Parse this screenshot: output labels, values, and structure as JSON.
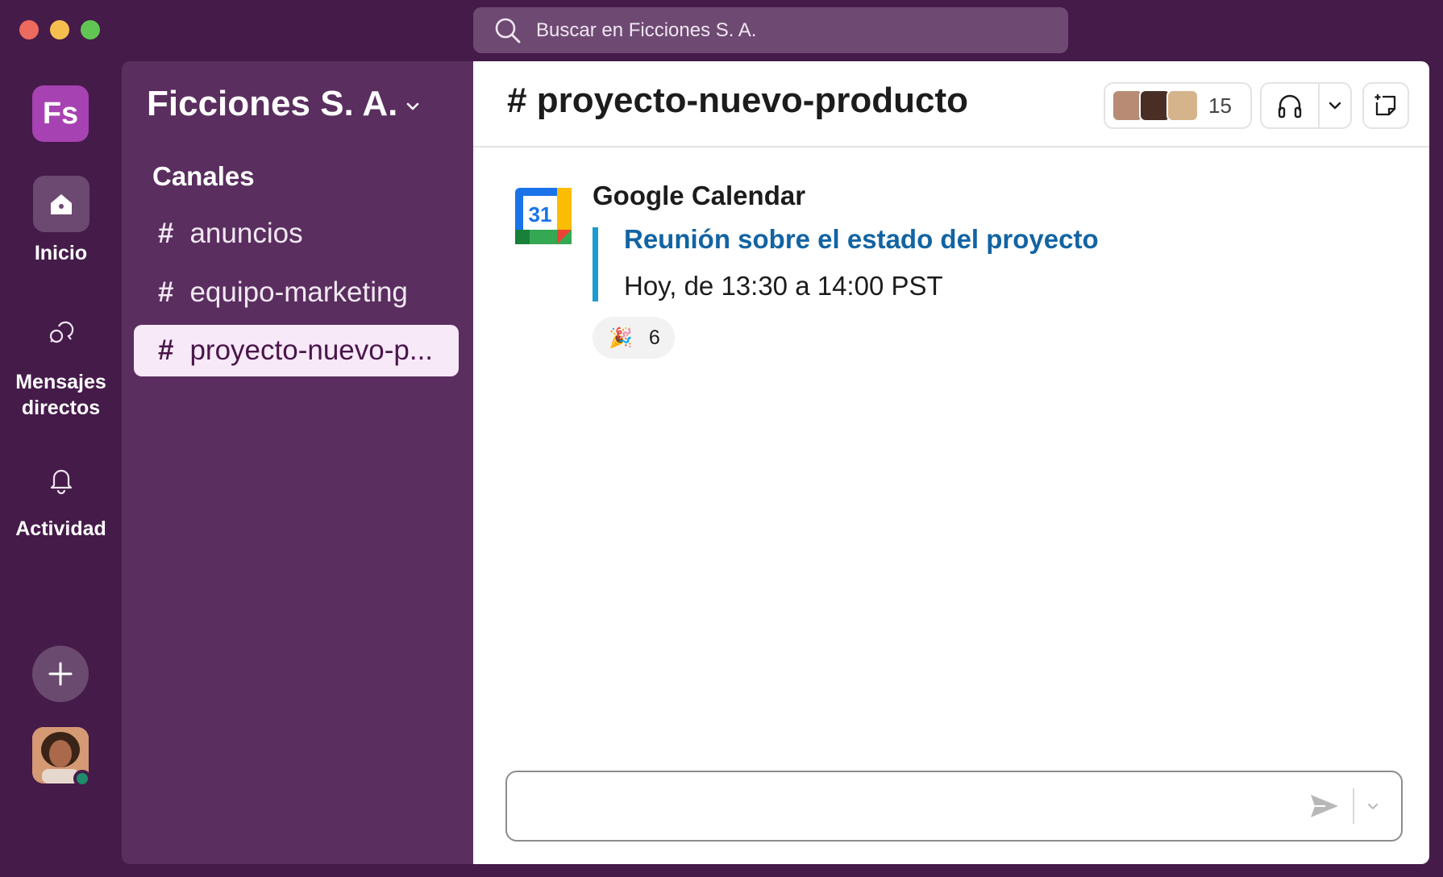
{
  "search": {
    "placeholder": "Buscar en Ficciones S. A."
  },
  "rail": {
    "workspace_initials": "Fs",
    "items": [
      {
        "label": "Inicio",
        "icon": "home-icon"
      },
      {
        "label": "Mensajes directos",
        "icon": "dm-icon"
      },
      {
        "label": "Actividad",
        "icon": "bell-icon"
      }
    ]
  },
  "sidebar": {
    "workspace_name": "Ficciones S. A.",
    "section_label": "Canales",
    "channels": [
      {
        "hash": "#",
        "name": "anuncios"
      },
      {
        "hash": "#",
        "name": "equipo-marketing"
      },
      {
        "hash": "#",
        "name": "proyecto-nuevo-p..."
      }
    ]
  },
  "main": {
    "channel_title": "# proyecto-nuevo-producto",
    "members_count": "15"
  },
  "message": {
    "author": "Google Calendar",
    "calendar_day": "31",
    "attachment_title": "Reunión sobre el estado del proyecto",
    "attachment_subtitle": "Hoy, de 13:30 a 14:00 PST",
    "reaction_emoji": "🎉",
    "reaction_count": "6"
  },
  "colors": {
    "window_bg": "#451b4a",
    "sidebar_bg": "#5a2e5f",
    "workspace_logo": "#a742b2",
    "link": "#1264a3",
    "attachment_bar": "#1d9bd1"
  }
}
